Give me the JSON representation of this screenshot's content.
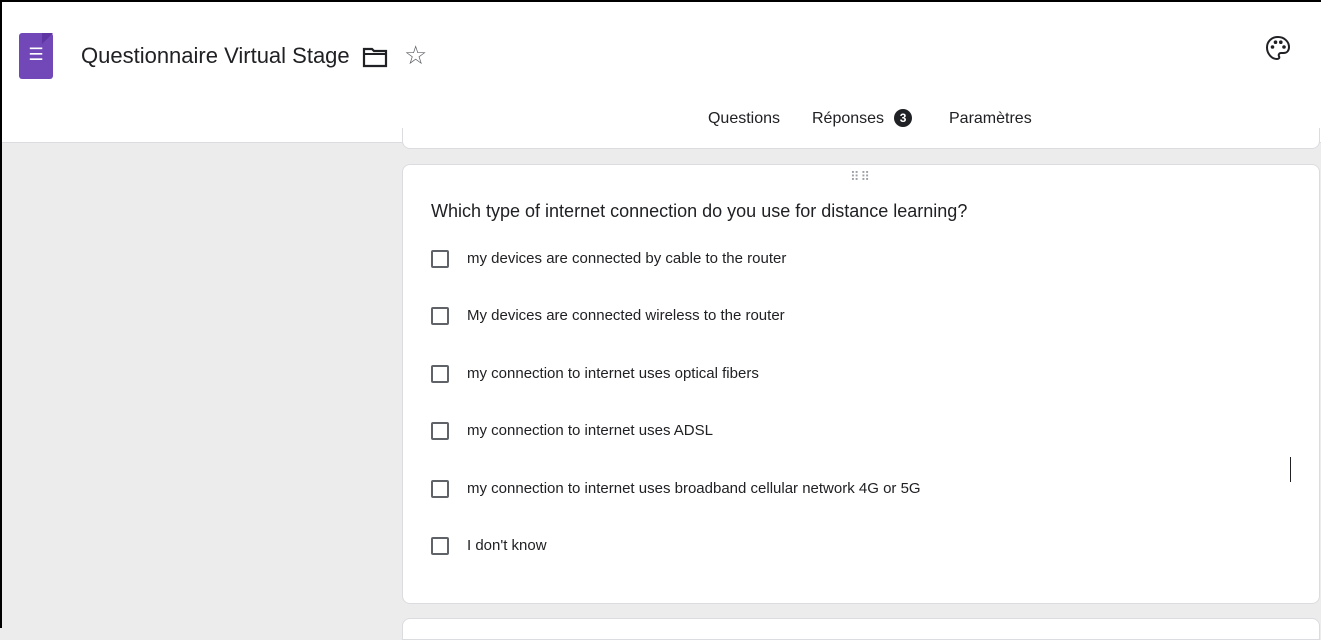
{
  "header": {
    "title": "Questionnaire Virtual Stage",
    "logo_icon": "google-forms-icon",
    "icons": [
      "folder-icon",
      "star-icon",
      "palette-icon"
    ]
  },
  "tabs": [
    {
      "label": "Questions",
      "active": true
    },
    {
      "label": "Réponses",
      "badge": "3"
    },
    {
      "label": "Paramètres"
    }
  ],
  "question": {
    "title": "Which type of internet connection do you use for distance learning?",
    "options": [
      "my devices are connected by cable to the router",
      "My devices are connected wireless to the router",
      "my connection to internet uses optical fibers",
      "my connection to internet uses ADSL",
      "my connection to internet uses broadband cellular network 4G or 5G",
      "I don't know"
    ]
  },
  "colors": {
    "brand": "#7248b9",
    "background": "#ececec",
    "card": "#ffffff",
    "text": "#202124"
  }
}
